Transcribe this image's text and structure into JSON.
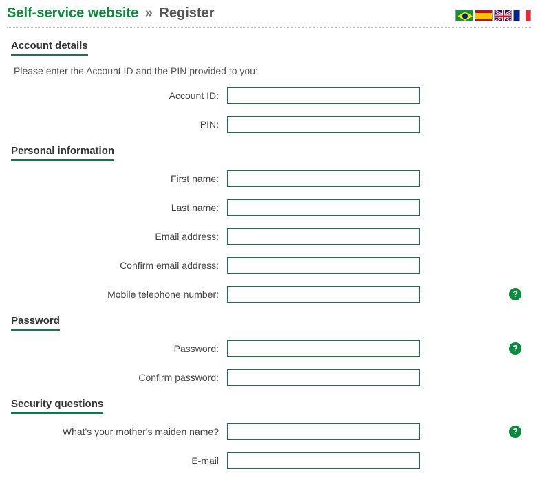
{
  "header": {
    "site_title": "Self-service website",
    "separator": "»",
    "page_title": "Register"
  },
  "flags": [
    {
      "name": "brazil-flag-icon"
    },
    {
      "name": "spain-flag-icon"
    },
    {
      "name": "uk-flag-icon"
    },
    {
      "name": "france-flag-icon"
    }
  ],
  "sections": {
    "account": {
      "heading": "Account details",
      "intro": "Please enter the Account ID and the PIN provided to you:",
      "fields": {
        "account_id": {
          "label": "Account ID:",
          "value": ""
        },
        "pin": {
          "label": "PIN:",
          "value": ""
        }
      }
    },
    "personal": {
      "heading": "Personal information",
      "fields": {
        "first_name": {
          "label": "First name:",
          "value": ""
        },
        "last_name": {
          "label": "Last name:",
          "value": ""
        },
        "email": {
          "label": "Email address:",
          "value": ""
        },
        "confirm_email": {
          "label": "Confirm email address:",
          "value": ""
        },
        "mobile": {
          "label": "Mobile telephone number:",
          "value": ""
        }
      }
    },
    "password": {
      "heading": "Password",
      "fields": {
        "password": {
          "label": "Password:",
          "value": ""
        },
        "confirm_password": {
          "label": "Confirm password:",
          "value": ""
        }
      }
    },
    "security": {
      "heading": "Security questions",
      "fields": {
        "q1": {
          "label": "What's your mother's maiden name?",
          "value": ""
        },
        "q2": {
          "label": "E-mail",
          "value": ""
        }
      }
    }
  },
  "help_glyph": "?"
}
